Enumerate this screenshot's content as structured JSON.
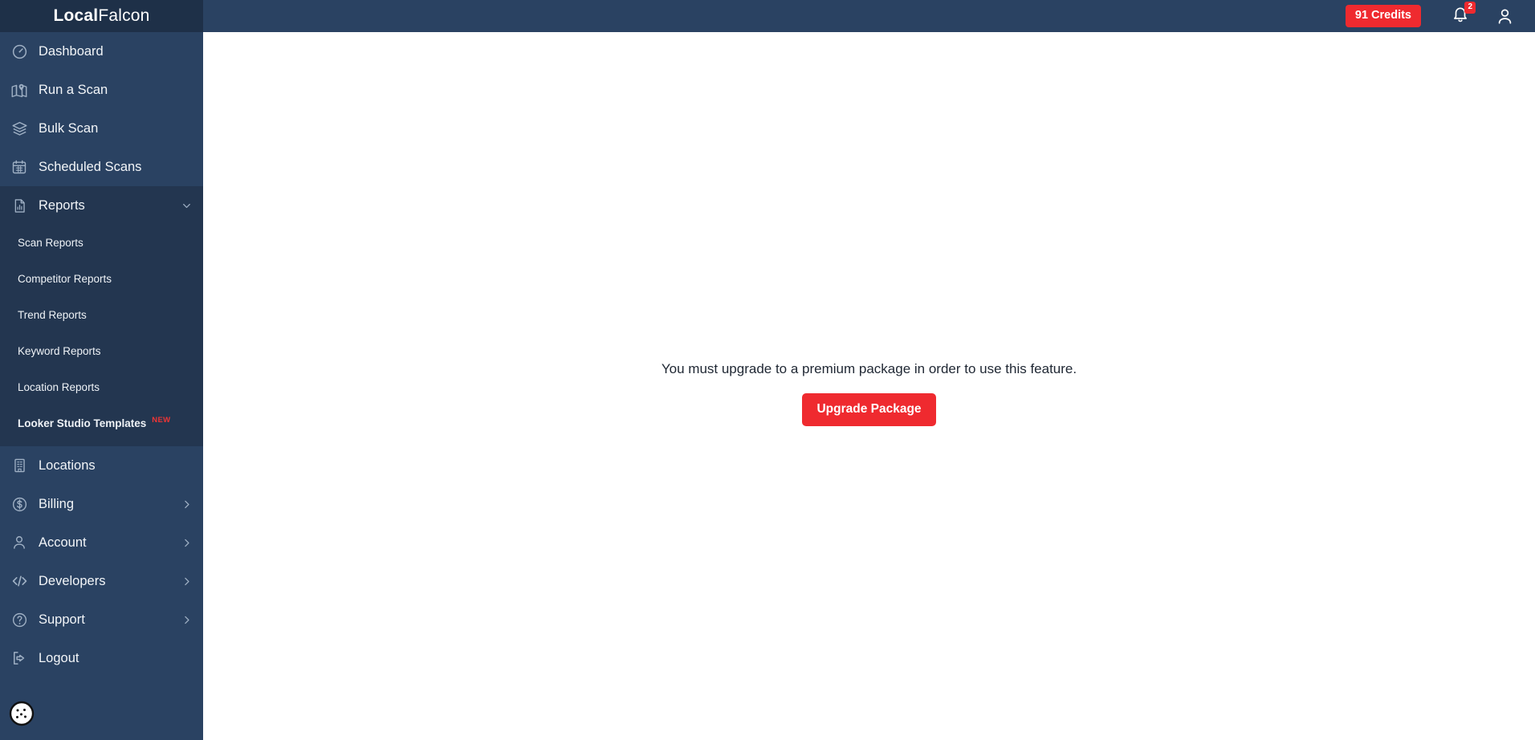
{
  "brand": {
    "name_bold": "Local",
    "name_light": "Falcon",
    "accent_red": "#ef2a2f",
    "sidebar_bg": "#2a4262",
    "sidebar_header_bg": "#1e3048",
    "submenu_bg": "#233650"
  },
  "topbar": {
    "credits_label": "91 Credits",
    "notifications_count": "2",
    "bell_icon": "bell-icon",
    "avatar_icon": "user-avatar-icon"
  },
  "sidebar": {
    "items": [
      {
        "label": "Dashboard",
        "icon": "gauge-icon",
        "chevron": "",
        "active": false
      },
      {
        "label": "Run a Scan",
        "icon": "map-pin-icon",
        "chevron": "",
        "active": false
      },
      {
        "label": "Bulk Scan",
        "icon": "layers-icon",
        "chevron": "",
        "active": false
      },
      {
        "label": "Scheduled Scans",
        "icon": "calendar-icon",
        "chevron": "",
        "active": false
      },
      {
        "label": "Reports",
        "icon": "document-chart-icon",
        "chevron": "down",
        "active": true
      }
    ],
    "submenu": [
      {
        "label": "Scan Reports",
        "badge": "",
        "strong": false
      },
      {
        "label": "Competitor Reports",
        "badge": "",
        "strong": false
      },
      {
        "label": "Trend Reports",
        "badge": "",
        "strong": false
      },
      {
        "label": "Keyword Reports",
        "badge": "",
        "strong": false
      },
      {
        "label": "Location Reports",
        "badge": "",
        "strong": false
      },
      {
        "label": "Looker Studio Templates",
        "badge": "NEW",
        "strong": true
      }
    ],
    "items_lower": [
      {
        "label": "Locations",
        "icon": "building-icon",
        "chevron": ""
      },
      {
        "label": "Billing",
        "icon": "dollar-circle-icon",
        "chevron": "right"
      },
      {
        "label": "Account",
        "icon": "person-icon",
        "chevron": "right"
      },
      {
        "label": "Developers",
        "icon": "code-brackets-icon",
        "chevron": "right"
      },
      {
        "label": "Support",
        "icon": "question-circle-icon",
        "chevron": "right"
      },
      {
        "label": "Logout",
        "icon": "sign-out-icon",
        "chevron": ""
      }
    ],
    "cookie_icon": "cookie-icon"
  },
  "main": {
    "notice": "You must upgrade to a premium package in order to use this feature.",
    "upgrade_button": "Upgrade Package"
  }
}
